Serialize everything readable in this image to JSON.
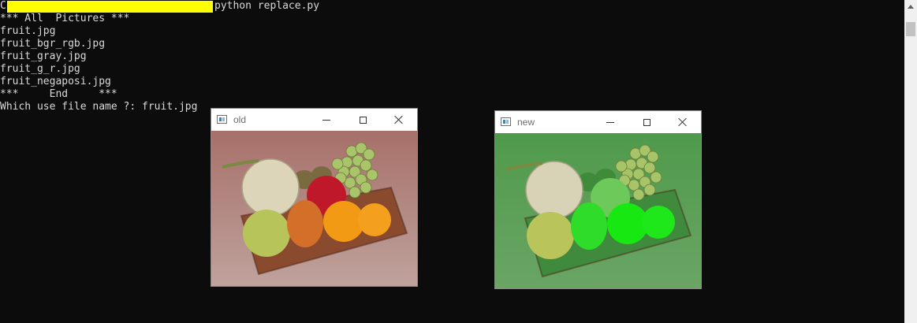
{
  "console": {
    "prompt_drive": "C:",
    "prompt_command": "python replace.py",
    "lines": [
      "*** All  Pictures ***",
      "fruit.jpg",
      "fruit_bgr_rgb.jpg",
      "fruit_gray.jpg",
      "fruit_g_r.jpg",
      "fruit_negaposi.jpg",
      "***     End     ***",
      "Which use file name ?: fruit.jpg"
    ],
    "background": "#0c0c0c",
    "text_color": "#d9d9d9",
    "redaction_color": "#ffff00"
  },
  "windows": {
    "old": {
      "title": "old",
      "icon": "window-app-icon",
      "palette": {
        "bg_top": "#a7706a",
        "bg_bottom": "#bfa29c",
        "basket": "#8a4a2e",
        "melon": "#dcd5ba",
        "apple_green": "#b7c45a",
        "mango": "#d46f2a",
        "orange1": "#f29a14",
        "orange2": "#f4a01e",
        "apple_red": "#c0182b",
        "kiwi": "#7a6a40",
        "grape": "#a9c46a"
      }
    },
    "new": {
      "title": "new",
      "icon": "window-app-icon",
      "palette": {
        "bg_top": "#4f9a4c",
        "bg_bottom": "#6aa564",
        "basket": "#3f8a3c",
        "melon": "#d8d2b6",
        "apple_green": "#b9c45a",
        "mango": "#2fdc2a",
        "orange1": "#17e812",
        "orange2": "#1ee81a",
        "apple_red": "#6cc95a",
        "kiwi": "#3e8c3a",
        "grape": "#a7c468"
      }
    }
  }
}
